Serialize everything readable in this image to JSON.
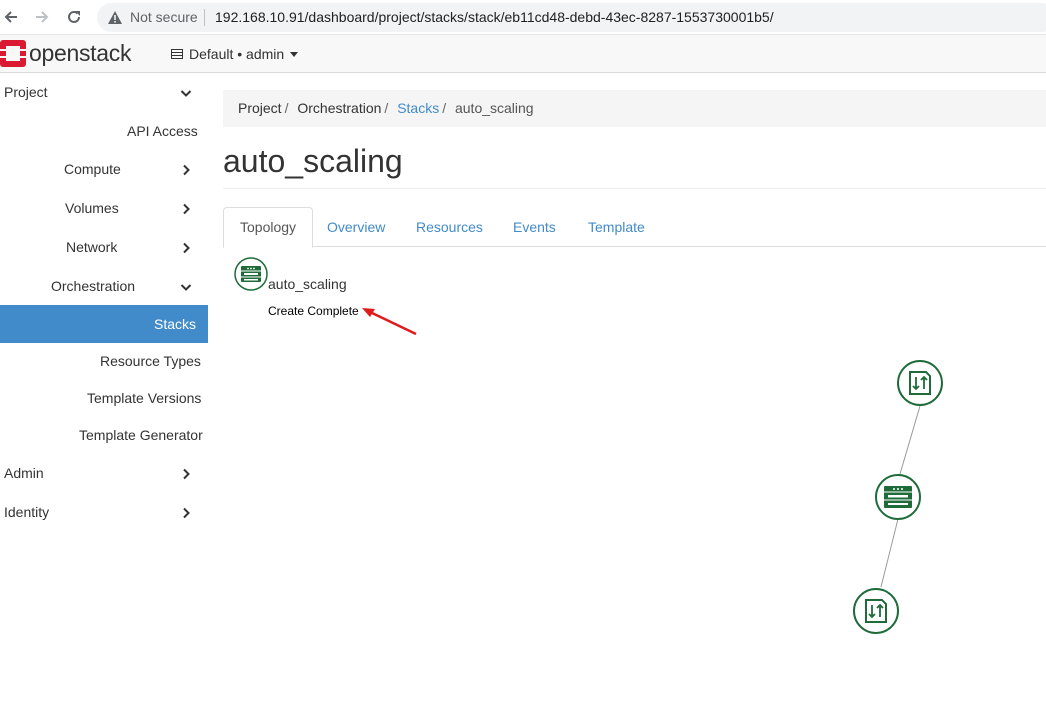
{
  "browser": {
    "security_label": "Not secure",
    "url": "192.168.10.91/dashboard/project/stacks/stack/eb11cd48-debd-43ec-8287-1553730001b5/"
  },
  "header": {
    "logo_text": "openstack",
    "context": "Default • admin"
  },
  "sidebar": {
    "project": "Project",
    "api_access": "API Access",
    "compute": "Compute",
    "volumes": "Volumes",
    "network": "Network",
    "orchestration": "Orchestration",
    "stacks": "Stacks",
    "resource_types": "Resource Types",
    "template_versions": "Template Versions",
    "template_generator": "Template Generator",
    "admin": "Admin",
    "identity": "Identity"
  },
  "breadcrumb": {
    "project": "Project",
    "orchestration": "Orchestration",
    "stacks": "Stacks",
    "current": "auto_scaling",
    "separator": "/"
  },
  "page": {
    "title": "auto_scaling"
  },
  "tabs": {
    "topology": "Topology",
    "overview": "Overview",
    "resources": "Resources",
    "events": "Events",
    "template": "Template"
  },
  "topology": {
    "stack_name": "auto_scaling",
    "stack_status": "Create Complete",
    "node_color": "#1f6b3a",
    "accent_color": "#428bca",
    "arrow_color": "#e01b1b"
  }
}
